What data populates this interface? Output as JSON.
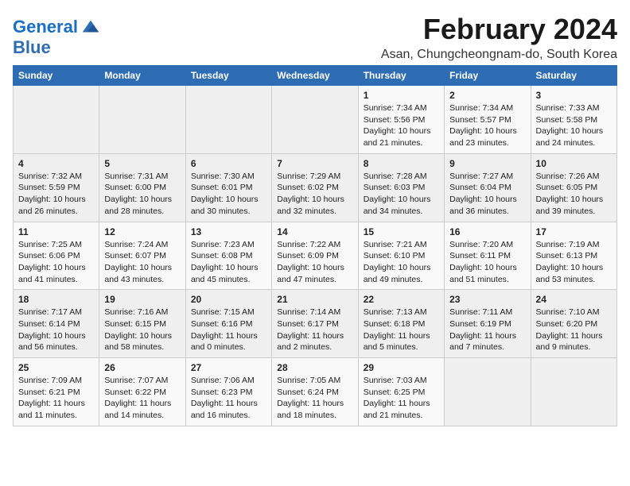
{
  "logo": {
    "line1": "General",
    "line2": "Blue"
  },
  "title": "February 2024",
  "subtitle": "Asan, Chungcheongnam-do, South Korea",
  "weekdays": [
    "Sunday",
    "Monday",
    "Tuesday",
    "Wednesday",
    "Thursday",
    "Friday",
    "Saturday"
  ],
  "weeks": [
    [
      {
        "day": "",
        "info": ""
      },
      {
        "day": "",
        "info": ""
      },
      {
        "day": "",
        "info": ""
      },
      {
        "day": "",
        "info": ""
      },
      {
        "day": "1",
        "info": "Sunrise: 7:34 AM\nSunset: 5:56 PM\nDaylight: 10 hours\nand 21 minutes."
      },
      {
        "day": "2",
        "info": "Sunrise: 7:34 AM\nSunset: 5:57 PM\nDaylight: 10 hours\nand 23 minutes."
      },
      {
        "day": "3",
        "info": "Sunrise: 7:33 AM\nSunset: 5:58 PM\nDaylight: 10 hours\nand 24 minutes."
      }
    ],
    [
      {
        "day": "4",
        "info": "Sunrise: 7:32 AM\nSunset: 5:59 PM\nDaylight: 10 hours\nand 26 minutes."
      },
      {
        "day": "5",
        "info": "Sunrise: 7:31 AM\nSunset: 6:00 PM\nDaylight: 10 hours\nand 28 minutes."
      },
      {
        "day": "6",
        "info": "Sunrise: 7:30 AM\nSunset: 6:01 PM\nDaylight: 10 hours\nand 30 minutes."
      },
      {
        "day": "7",
        "info": "Sunrise: 7:29 AM\nSunset: 6:02 PM\nDaylight: 10 hours\nand 32 minutes."
      },
      {
        "day": "8",
        "info": "Sunrise: 7:28 AM\nSunset: 6:03 PM\nDaylight: 10 hours\nand 34 minutes."
      },
      {
        "day": "9",
        "info": "Sunrise: 7:27 AM\nSunset: 6:04 PM\nDaylight: 10 hours\nand 36 minutes."
      },
      {
        "day": "10",
        "info": "Sunrise: 7:26 AM\nSunset: 6:05 PM\nDaylight: 10 hours\nand 39 minutes."
      }
    ],
    [
      {
        "day": "11",
        "info": "Sunrise: 7:25 AM\nSunset: 6:06 PM\nDaylight: 10 hours\nand 41 minutes."
      },
      {
        "day": "12",
        "info": "Sunrise: 7:24 AM\nSunset: 6:07 PM\nDaylight: 10 hours\nand 43 minutes."
      },
      {
        "day": "13",
        "info": "Sunrise: 7:23 AM\nSunset: 6:08 PM\nDaylight: 10 hours\nand 45 minutes."
      },
      {
        "day": "14",
        "info": "Sunrise: 7:22 AM\nSunset: 6:09 PM\nDaylight: 10 hours\nand 47 minutes."
      },
      {
        "day": "15",
        "info": "Sunrise: 7:21 AM\nSunset: 6:10 PM\nDaylight: 10 hours\nand 49 minutes."
      },
      {
        "day": "16",
        "info": "Sunrise: 7:20 AM\nSunset: 6:11 PM\nDaylight: 10 hours\nand 51 minutes."
      },
      {
        "day": "17",
        "info": "Sunrise: 7:19 AM\nSunset: 6:13 PM\nDaylight: 10 hours\nand 53 minutes."
      }
    ],
    [
      {
        "day": "18",
        "info": "Sunrise: 7:17 AM\nSunset: 6:14 PM\nDaylight: 10 hours\nand 56 minutes."
      },
      {
        "day": "19",
        "info": "Sunrise: 7:16 AM\nSunset: 6:15 PM\nDaylight: 10 hours\nand 58 minutes."
      },
      {
        "day": "20",
        "info": "Sunrise: 7:15 AM\nSunset: 6:16 PM\nDaylight: 11 hours\nand 0 minutes."
      },
      {
        "day": "21",
        "info": "Sunrise: 7:14 AM\nSunset: 6:17 PM\nDaylight: 11 hours\nand 2 minutes."
      },
      {
        "day": "22",
        "info": "Sunrise: 7:13 AM\nSunset: 6:18 PM\nDaylight: 11 hours\nand 5 minutes."
      },
      {
        "day": "23",
        "info": "Sunrise: 7:11 AM\nSunset: 6:19 PM\nDaylight: 11 hours\nand 7 minutes."
      },
      {
        "day": "24",
        "info": "Sunrise: 7:10 AM\nSunset: 6:20 PM\nDaylight: 11 hours\nand 9 minutes."
      }
    ],
    [
      {
        "day": "25",
        "info": "Sunrise: 7:09 AM\nSunset: 6:21 PM\nDaylight: 11 hours\nand 11 minutes."
      },
      {
        "day": "26",
        "info": "Sunrise: 7:07 AM\nSunset: 6:22 PM\nDaylight: 11 hours\nand 14 minutes."
      },
      {
        "day": "27",
        "info": "Sunrise: 7:06 AM\nSunset: 6:23 PM\nDaylight: 11 hours\nand 16 minutes."
      },
      {
        "day": "28",
        "info": "Sunrise: 7:05 AM\nSunset: 6:24 PM\nDaylight: 11 hours\nand 18 minutes."
      },
      {
        "day": "29",
        "info": "Sunrise: 7:03 AM\nSunset: 6:25 PM\nDaylight: 11 hours\nand 21 minutes."
      },
      {
        "day": "",
        "info": ""
      },
      {
        "day": "",
        "info": ""
      }
    ]
  ]
}
